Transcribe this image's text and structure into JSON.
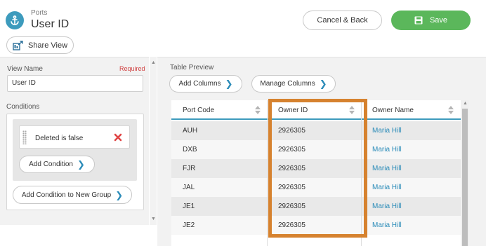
{
  "header": {
    "subtitle": "Ports",
    "title": "User ID",
    "cancel_label": "Cancel & Back",
    "save_label": "Save",
    "share_label": "Share View"
  },
  "left": {
    "view_name_label": "View Name",
    "required_label": "Required",
    "view_name_value": "User ID",
    "conditions_label": "Conditions",
    "condition_text": "Deleted is false",
    "add_condition_label": "Add Condition",
    "add_group_label": "Add Condition to New Group"
  },
  "preview": {
    "label": "Table Preview",
    "add_columns_label": "Add Columns",
    "manage_columns_label": "Manage Columns",
    "columns": [
      "Port Code",
      "Owner ID",
      "Owner Name"
    ],
    "rows": [
      [
        "AUH",
        "2926305",
        "Maria Hill"
      ],
      [
        "DXB",
        "2926305",
        "Maria Hill"
      ],
      [
        "FJR",
        "2926305",
        "Maria Hill"
      ],
      [
        "JAL",
        "2926305",
        "Maria Hill"
      ],
      [
        "JE1",
        "2926305",
        "Maria Hill"
      ],
      [
        "JE2",
        "2926305",
        "Maria Hill"
      ]
    ]
  },
  "colors": {
    "accent": "#3d9bbd",
    "save": "#5bb75b",
    "highlight": "#d6822f",
    "danger": "#e04545",
    "link": "#2a8bb8"
  },
  "icons": [
    "anchor-icon",
    "save-icon",
    "share-icon",
    "delete-x-icon",
    "chevron-right-icon",
    "sort-icon",
    "drag-handle-icon"
  ]
}
